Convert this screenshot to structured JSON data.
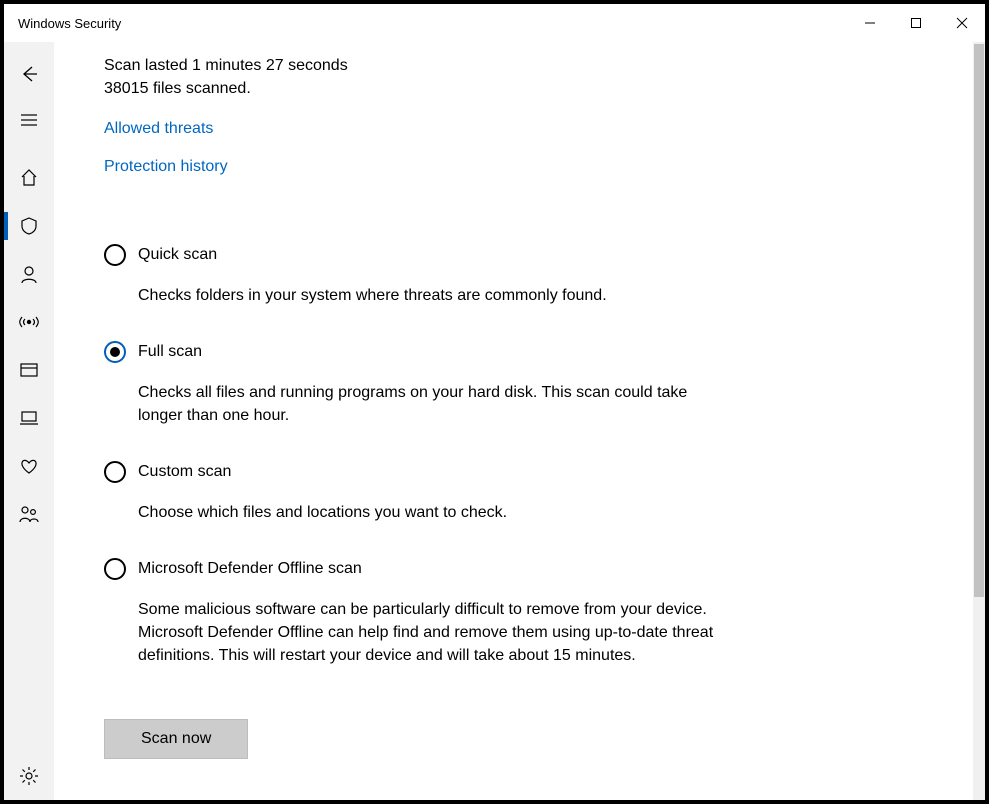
{
  "window": {
    "title": "Windows Security"
  },
  "status": {
    "line1": "Scan lasted 1 minutes 27 seconds",
    "line2": "38015 files scanned."
  },
  "links": {
    "allowed_threats": "Allowed threats",
    "protection_history": "Protection history"
  },
  "scan_options": [
    {
      "id": "quick",
      "title": "Quick scan",
      "desc": "Checks folders in your system where threats are commonly found.",
      "selected": false
    },
    {
      "id": "full",
      "title": "Full scan",
      "desc": "Checks all files and running programs on your hard disk. This scan could take longer than one hour.",
      "selected": true
    },
    {
      "id": "custom",
      "title": "Custom scan",
      "desc": "Choose which files and locations you want to check.",
      "selected": false
    },
    {
      "id": "offline",
      "title": "Microsoft Defender Offline scan",
      "desc": "Some malicious software can be particularly difficult to remove from your device. Microsoft Defender Offline can help find and remove them using up-to-date threat definitions. This will restart your device and will take about 15 minutes.",
      "selected": false
    }
  ],
  "buttons": {
    "scan_now": "Scan now"
  },
  "sidebar": {
    "items": [
      {
        "name": "back",
        "icon": "back-arrow"
      },
      {
        "name": "menu",
        "icon": "hamburger"
      },
      {
        "name": "home",
        "icon": "home"
      },
      {
        "name": "virus-threat",
        "icon": "shield",
        "selected": true
      },
      {
        "name": "account",
        "icon": "person"
      },
      {
        "name": "firewall",
        "icon": "antenna"
      },
      {
        "name": "app-browser",
        "icon": "window"
      },
      {
        "name": "device-security",
        "icon": "laptop"
      },
      {
        "name": "performance",
        "icon": "heart"
      },
      {
        "name": "family",
        "icon": "family"
      }
    ],
    "settings": {
      "name": "settings",
      "icon": "gear"
    }
  }
}
